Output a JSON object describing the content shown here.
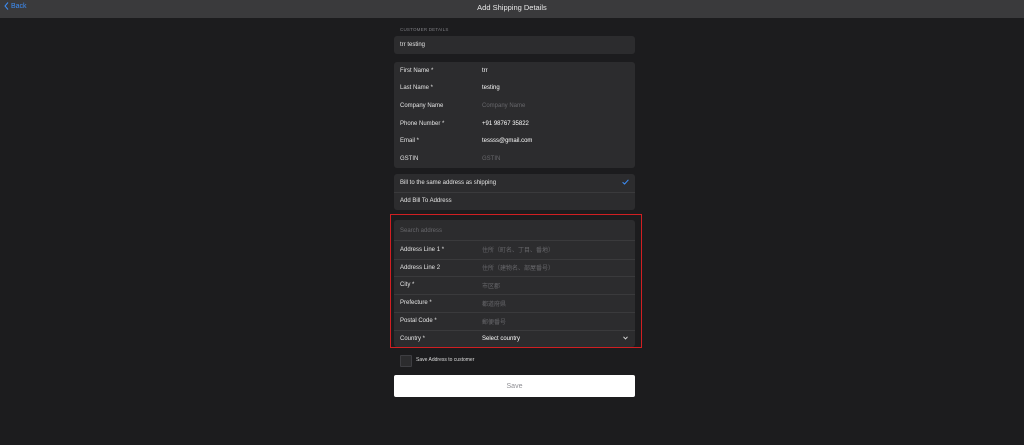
{
  "header": {
    "back_label": "Back",
    "title": "Add Shipping Details"
  },
  "customer": {
    "section_label": "CUSTOMER DETAILS",
    "name": "trr testing"
  },
  "contact": {
    "first_name": {
      "label": "First Name *",
      "value": "trr"
    },
    "last_name": {
      "label": "Last Name *",
      "value": "testing"
    },
    "company": {
      "label": "Company Name",
      "placeholder": "Company Name"
    },
    "phone": {
      "label": "Phone Number *",
      "value": "+91 98767 35822"
    },
    "email": {
      "label": "Email *",
      "value": "tessss@gmail.com"
    },
    "gstin": {
      "label": "GSTIN",
      "placeholder": "GSTIN"
    }
  },
  "billing": {
    "same_address_label": "Bill to the same address as shipping",
    "same_address_checked": true,
    "add_bill_to_label": "Add Bill To Address"
  },
  "address": {
    "search_placeholder": "Search address",
    "line1": {
      "label": "Address Line 1 *",
      "placeholder": "住所（町名、丁目、番地）"
    },
    "line2": {
      "label": "Address Line 2",
      "placeholder": "住所（建物名、部屋番号）"
    },
    "city": {
      "label": "City *",
      "placeholder": "市区郡"
    },
    "prefecture": {
      "label": "Prefecture *",
      "placeholder": "都道府県"
    },
    "postal_code": {
      "label": "Postal Code *",
      "placeholder": "郵便番号"
    },
    "country": {
      "label": "Country *",
      "value": "Select country"
    }
  },
  "save_address_label": "Save Address to customer",
  "save_button_label": "Save",
  "colors": {
    "accent": "#3d8ef7",
    "highlight": "#d01f22",
    "background": "#1c1c1e",
    "card": "#2c2c2e"
  }
}
